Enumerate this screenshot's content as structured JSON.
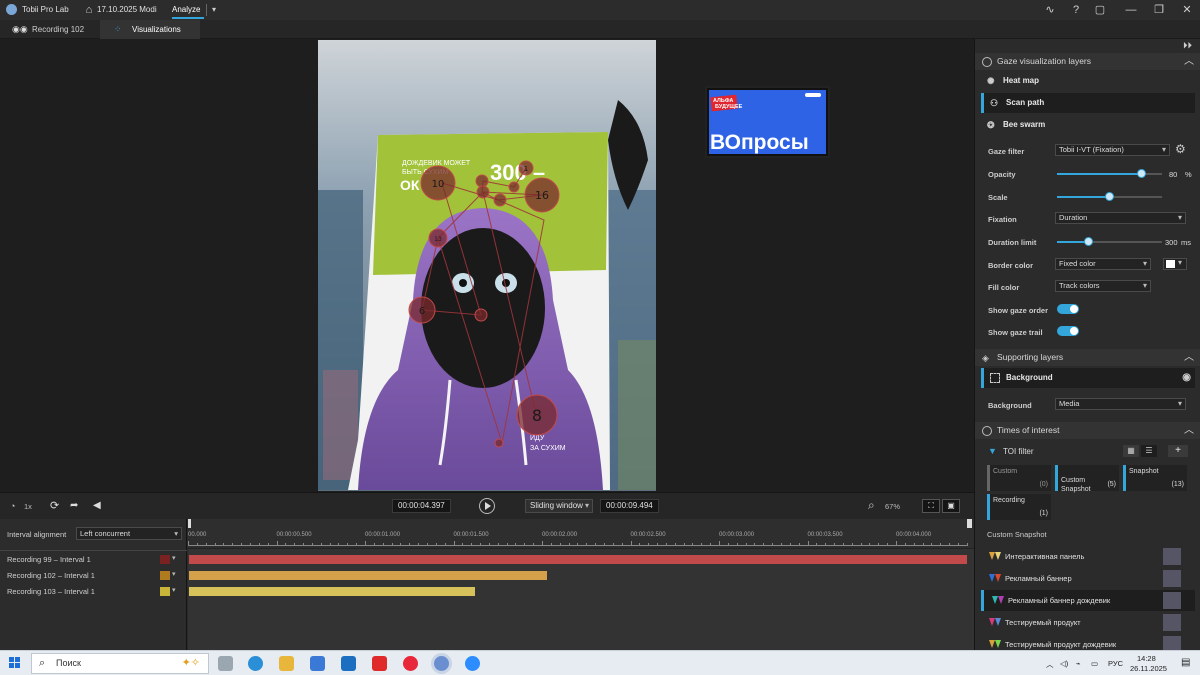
{
  "app": {
    "name": "Tobii Pro Lab",
    "project": "17.10.2025 Modi",
    "mode": "Analyze"
  },
  "tabs": [
    {
      "label": "Recording 102"
    },
    {
      "label": "Visualizations"
    }
  ],
  "stage": {
    "poster": {
      "headline_top": "ДОЖДЕВИК МОЖЕТ\nБЫТЬ СУХИМ",
      "headline_big": "ОК",
      "price": "300 ₽",
      "tagline": "ИДУ\nЗА СУХИМ"
    },
    "monitor": {
      "brand": "АЛЬФА\nБУДУЩЕЕ",
      "text": "ВОпросы"
    },
    "gaze_order_labels": [
      "1",
      "10",
      "16",
      "13",
      "6",
      "8"
    ]
  },
  "player": {
    "speed": "1x",
    "current_time": "00:00:04.397",
    "window_mode": "Sliding window",
    "window_length": "00:00:09.494",
    "zoom": "67%"
  },
  "timeline": {
    "alignment_label": "Interval alignment",
    "alignment_value": "Left concurrent",
    "ticks": [
      "00.000",
      "00:00:00.500",
      "00:00:01.000",
      "00:00:01.500",
      "00:00:02.000",
      "00:00:02.500",
      "00:00:03.000",
      "00:00:03.500",
      "00:00:04.000"
    ],
    "recordings": [
      {
        "label": "Recording 99 – Interval 1",
        "color": "#c24a4a",
        "fraction": 1.0
      },
      {
        "label": "Recording 102 – Interval 1",
        "color": "#d4a04a",
        "fraction": 0.46
      },
      {
        "label": "Recording 103 – Interval 1",
        "color": "#d6c15a",
        "fraction": 0.368
      }
    ]
  },
  "panel": {
    "gaze_section": {
      "title": "Gaze visualization layers",
      "layers": [
        {
          "label": "Heat map",
          "icon": "heatmap-icon"
        },
        {
          "label": "Scan path",
          "icon": "scanpath-icon",
          "selected": true
        },
        {
          "label": "Bee swarm",
          "icon": "beeswarm-icon"
        }
      ],
      "gaze_filter_label": "Gaze filter",
      "gaze_filter_value": "Tobii I-VT (Fixation)",
      "opacity_label": "Opacity",
      "opacity_value": "80",
      "opacity_unit": "%",
      "opacity_fraction": 0.8,
      "scale_label": "Scale",
      "scale_fraction": 0.5,
      "fixation_label": "Fixation",
      "fixation_value": "Duration",
      "duration_limit_label": "Duration limit",
      "duration_limit_value": "300",
      "duration_limit_unit": "ms",
      "duration_limit_fraction": 0.3,
      "border_color_label": "Border color",
      "border_color_value": "Fixed color",
      "fill_color_label": "Fill color",
      "fill_color_value": "Track colors",
      "show_gaze_order_label": "Show gaze order",
      "show_gaze_trail_label": "Show gaze trail"
    },
    "supporting_section": {
      "title": "Supporting layers",
      "layer": "Background",
      "background_label": "Background",
      "background_value": "Media"
    },
    "toi_section": {
      "title": "Times of interest",
      "filter_label": "TOI filter",
      "cards": [
        {
          "label": "Custom",
          "count": "(0)"
        },
        {
          "label": "Custom\nSnapshot",
          "count": "(5)"
        },
        {
          "label": "Snapshot",
          "count": "(13)"
        },
        {
          "label": "Recording",
          "count": "(1)"
        }
      ],
      "group_label": "Custom Snapshot",
      "items": [
        {
          "label": "Интерактивная панель",
          "c1": "#d9a23a",
          "c2": "#e6d27a"
        },
        {
          "label": "Рекламный баннер",
          "c1": "#2f6fd6",
          "c2": "#d64a2f"
        },
        {
          "label": "Рекламный баннер дождевик",
          "c1": "#2fb8b0",
          "c2": "#b03fb0",
          "selected": true
        },
        {
          "label": "Тестируемый  продукт",
          "c1": "#d63a7a",
          "c2": "#5a8ad6"
        },
        {
          "label": "Тестируемый продукт дождевик",
          "c1": "#d6a23a",
          "c2": "#7ad64a"
        }
      ]
    }
  },
  "taskbar": {
    "search_placeholder": "Поиск",
    "lang": "РУС",
    "time": "14:28",
    "date": "26.11.2025"
  }
}
